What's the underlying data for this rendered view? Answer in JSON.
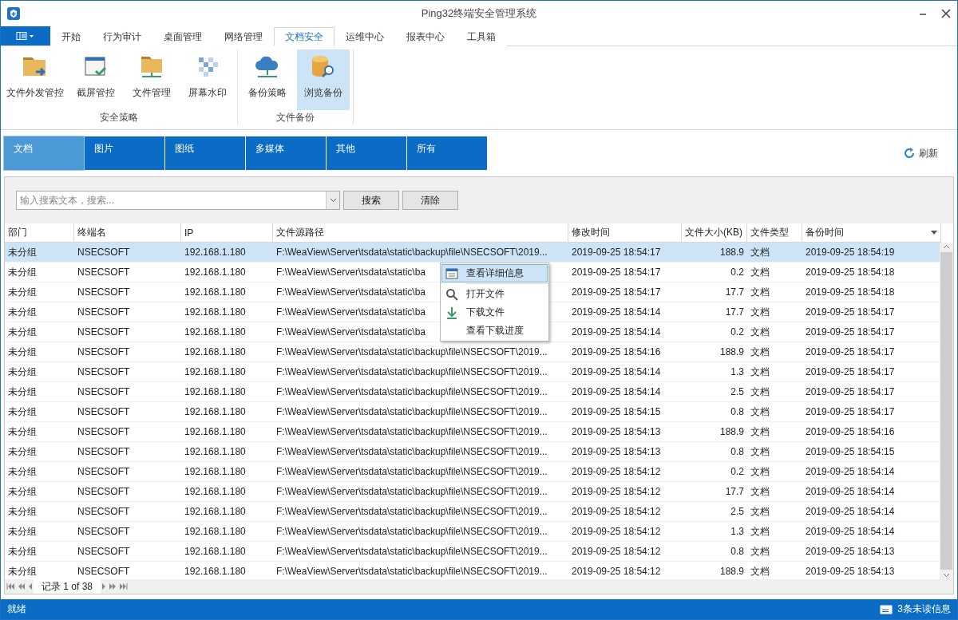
{
  "window": {
    "title": "Ping32终端安全管理系统"
  },
  "ribbon_tabs": [
    {
      "label": "开始",
      "selected": false
    },
    {
      "label": "行为审计",
      "selected": false
    },
    {
      "label": "桌面管理",
      "selected": false
    },
    {
      "label": "网络管理",
      "selected": false
    },
    {
      "label": "文档安全",
      "selected": true
    },
    {
      "label": "运维中心",
      "selected": false
    },
    {
      "label": "报表中心",
      "selected": false
    },
    {
      "label": "工具箱",
      "selected": false
    }
  ],
  "ribbon_groups": [
    {
      "label": "安全策略",
      "buttons": [
        {
          "label": "文件外发管控",
          "kind": "folder-send",
          "selected": false
        },
        {
          "label": "截屏管控",
          "kind": "screen-check",
          "selected": false
        },
        {
          "label": "文件管理",
          "kind": "folder-net",
          "selected": false
        },
        {
          "label": "屏幕水印",
          "kind": "mosaic",
          "selected": false
        }
      ]
    },
    {
      "label": "文件备份",
      "buttons": [
        {
          "label": "备份策略",
          "kind": "cloud",
          "selected": false
        },
        {
          "label": "浏览备份",
          "kind": "database",
          "selected": true
        }
      ]
    }
  ],
  "category_tabs": [
    {
      "label": "文档",
      "selected": true
    },
    {
      "label": "图片",
      "selected": false
    },
    {
      "label": "图纸",
      "selected": false
    },
    {
      "label": "多媒体",
      "selected": false
    },
    {
      "label": "其他",
      "selected": false
    },
    {
      "label": "所有",
      "selected": false
    }
  ],
  "refresh": "刷新",
  "search": {
    "placeholder": "输入搜索文本，搜索...",
    "buttons": [
      "搜索",
      "清除"
    ]
  },
  "table": {
    "columns": [
      "部门",
      "终端名",
      "IP",
      "文件源路径",
      "修改时间",
      "文件大小(KB)",
      "文件类型",
      "备份时间"
    ],
    "rows": [
      {
        "cells": [
          "未分组",
          "NSECSOFT",
          "192.168.1.180",
          "F:\\WeaView\\Server\\tsdata\\static\\backup\\file\\NSECSOFT\\2019...",
          "2019-09-25 18:54:17",
          "188.9",
          "文档",
          "2019-09-25 18:54:19"
        ],
        "selected": true
      },
      {
        "cells": [
          "未分组",
          "NSECSOFT",
          "192.168.1.180",
          "F:\\WeaView\\Server\\tsdata\\static\\ba",
          "2019-09-25 18:54:17",
          "0.2",
          "文档",
          "2019-09-25 18:54:18"
        ],
        "selected": false
      },
      {
        "cells": [
          "未分组",
          "NSECSOFT",
          "192.168.1.180",
          "F:\\WeaView\\Server\\tsdata\\static\\ba",
          "2019-09-25 18:54:17",
          "17.7",
          "文档",
          "2019-09-25 18:54:18"
        ],
        "selected": false
      },
      {
        "cells": [
          "未分组",
          "NSECSOFT",
          "192.168.1.180",
          "F:\\WeaView\\Server\\tsdata\\static\\ba",
          "2019-09-25 18:54:14",
          "17.7",
          "文档",
          "2019-09-25 18:54:17"
        ],
        "selected": false
      },
      {
        "cells": [
          "未分组",
          "NSECSOFT",
          "192.168.1.180",
          "F:\\WeaView\\Server\\tsdata\\static\\ba",
          "2019-09-25 18:54:14",
          "0.2",
          "文档",
          "2019-09-25 18:54:17"
        ],
        "selected": false
      },
      {
        "cells": [
          "未分组",
          "NSECSOFT",
          "192.168.1.180",
          "F:\\WeaView\\Server\\tsdata\\static\\backup\\file\\NSECSOFT\\2019...",
          "2019-09-25 18:54:16",
          "188.9",
          "文档",
          "2019-09-25 18:54:17"
        ],
        "selected": false
      },
      {
        "cells": [
          "未分组",
          "NSECSOFT",
          "192.168.1.180",
          "F:\\WeaView\\Server\\tsdata\\static\\backup\\file\\NSECSOFT\\2019...",
          "2019-09-25 18:54:14",
          "1.3",
          "文档",
          "2019-09-25 18:54:17"
        ],
        "selected": false
      },
      {
        "cells": [
          "未分组",
          "NSECSOFT",
          "192.168.1.180",
          "F:\\WeaView\\Server\\tsdata\\static\\backup\\file\\NSECSOFT\\2019...",
          "2019-09-25 18:54:14",
          "2.5",
          "文档",
          "2019-09-25 18:54:17"
        ],
        "selected": false
      },
      {
        "cells": [
          "未分组",
          "NSECSOFT",
          "192.168.1.180",
          "F:\\WeaView\\Server\\tsdata\\static\\backup\\file\\NSECSOFT\\2019...",
          "2019-09-25 18:54:15",
          "0.8",
          "文档",
          "2019-09-25 18:54:17"
        ],
        "selected": false
      },
      {
        "cells": [
          "未分组",
          "NSECSOFT",
          "192.168.1.180",
          "F:\\WeaView\\Server\\tsdata\\static\\backup\\file\\NSECSOFT\\2019...",
          "2019-09-25 18:54:13",
          "188.9",
          "文档",
          "2019-09-25 18:54:16"
        ],
        "selected": false
      },
      {
        "cells": [
          "未分组",
          "NSECSOFT",
          "192.168.1.180",
          "F:\\WeaView\\Server\\tsdata\\static\\backup\\file\\NSECSOFT\\2019...",
          "2019-09-25 18:54:13",
          "0.8",
          "文档",
          "2019-09-25 18:54:15"
        ],
        "selected": false
      },
      {
        "cells": [
          "未分组",
          "NSECSOFT",
          "192.168.1.180",
          "F:\\WeaView\\Server\\tsdata\\static\\backup\\file\\NSECSOFT\\2019...",
          "2019-09-25 18:54:12",
          "0.2",
          "文档",
          "2019-09-25 18:54:14"
        ],
        "selected": false
      },
      {
        "cells": [
          "未分组",
          "NSECSOFT",
          "192.168.1.180",
          "F:\\WeaView\\Server\\tsdata\\static\\backup\\file\\NSECSOFT\\2019...",
          "2019-09-25 18:54:12",
          "17.7",
          "文档",
          "2019-09-25 18:54:14"
        ],
        "selected": false
      },
      {
        "cells": [
          "未分组",
          "NSECSOFT",
          "192.168.1.180",
          "F:\\WeaView\\Server\\tsdata\\static\\backup\\file\\NSECSOFT\\2019...",
          "2019-09-25 18:54:12",
          "2.5",
          "文档",
          "2019-09-25 18:54:14"
        ],
        "selected": false
      },
      {
        "cells": [
          "未分组",
          "NSECSOFT",
          "192.168.1.180",
          "F:\\WeaView\\Server\\tsdata\\static\\backup\\file\\NSECSOFT\\2019...",
          "2019-09-25 18:54:12",
          "1.3",
          "文档",
          "2019-09-25 18:54:14"
        ],
        "selected": false
      },
      {
        "cells": [
          "未分组",
          "NSECSOFT",
          "192.168.1.180",
          "F:\\WeaView\\Server\\tsdata\\static\\backup\\file\\NSECSOFT\\2019...",
          "2019-09-25 18:54:12",
          "0.8",
          "文档",
          "2019-09-25 18:54:13"
        ],
        "selected": false
      },
      {
        "cells": [
          "未分组",
          "NSECSOFT",
          "192.168.1.180",
          "F:\\WeaView\\Server\\tsdata\\static\\backup\\file\\NSECSOFT\\2019...",
          "2019-09-25 18:54:12",
          "188.9",
          "文档",
          "2019-09-25 18:54:13"
        ],
        "selected": false
      }
    ]
  },
  "context_menu": [
    {
      "label": "查看详细信息",
      "kind": "details",
      "selected": true
    },
    {
      "label": "打开文件",
      "kind": "open",
      "selected": false
    },
    {
      "label": "下载文件",
      "kind": "download",
      "selected": false
    },
    {
      "label": "查看下载进度",
      "kind": "progress",
      "selected": false
    }
  ],
  "navigator": {
    "record": "记录 1 of 38"
  },
  "status_bar": {
    "text": "就绪",
    "messages": "3条未读信息"
  }
}
